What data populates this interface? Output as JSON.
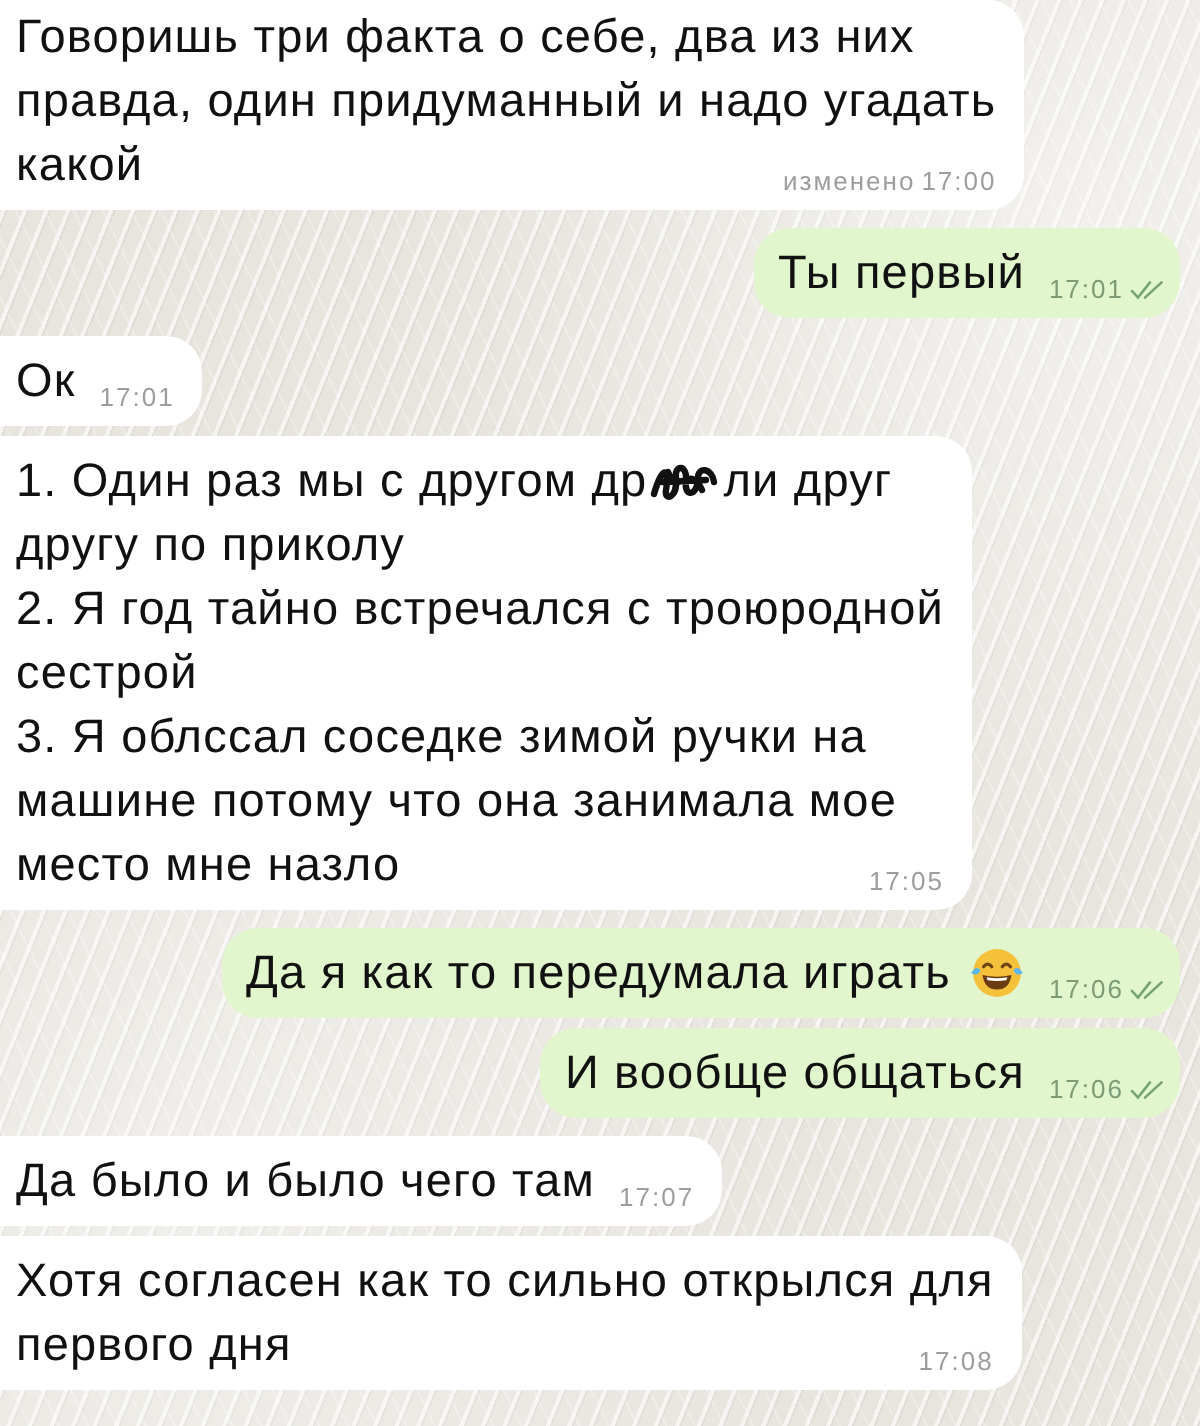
{
  "messages": [
    {
      "kind": "incoming",
      "parts": [
        {
          "kind": "text",
          "text": "Говоришь три факта о себе, два из них\nправда, один придуманный и надо угадать\nкакой"
        }
      ],
      "edited": "изменено",
      "time": "17:00"
    },
    {
      "kind": "outgoing",
      "parts": [
        {
          "kind": "text",
          "text": "Ты первый"
        }
      ],
      "time": "17:01",
      "read": true
    },
    {
      "kind": "incoming",
      "parts": [
        {
          "kind": "text",
          "text": "Ок"
        }
      ],
      "time": "17:01"
    },
    {
      "kind": "incoming",
      "parts": [
        {
          "kind": "text",
          "text": "1. Один раз мы с другом др"
        },
        {
          "kind": "scribble"
        },
        {
          "kind": "text",
          "text": "ли друг\nдругу по приколу\n2. Я год тайно встречался с троюродной\nсестрой\n3. Я облссал соседке зимой ручки на\nмашине потому что она занимала мое\nместо мне назло"
        }
      ],
      "time": "17:05"
    },
    {
      "kind": "outgoing",
      "parts": [
        {
          "kind": "text",
          "text": "Да я как то передумала играть"
        },
        {
          "kind": "emoji"
        }
      ],
      "time": "17:06",
      "read": true
    },
    {
      "kind": "outgoing",
      "parts": [
        {
          "kind": "text",
          "text": "И вообще общаться"
        }
      ],
      "time": "17:06",
      "read": true
    },
    {
      "kind": "incoming",
      "parts": [
        {
          "kind": "text",
          "text": "Да было и было чего там"
        }
      ],
      "time": "17:07"
    },
    {
      "kind": "incoming",
      "parts": [
        {
          "kind": "text",
          "text": "Хотя согласен как то сильно открылся для\nпервого дня"
        }
      ],
      "time": "17:08"
    }
  ]
}
